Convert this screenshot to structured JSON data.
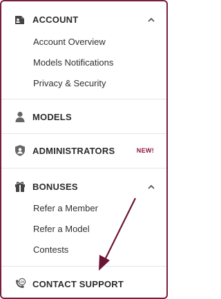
{
  "menu": {
    "account": {
      "label": "ACCOUNT",
      "items": [
        "Account Overview",
        "Models Notifications",
        "Privacy & Security"
      ]
    },
    "models": {
      "label": "MODELS"
    },
    "administrators": {
      "label": "ADMINISTRATORS",
      "badge": "NEW!"
    },
    "bonuses": {
      "label": "BONUSES",
      "items": [
        "Refer a Member",
        "Refer a Model",
        "Contests"
      ]
    },
    "contact": {
      "label": "CONTACT SUPPORT"
    }
  },
  "colors": {
    "frame": "#7a1d3a",
    "badge": "#8b1538",
    "icon": "#555555",
    "arrow": "#6b1535"
  },
  "icons": {
    "account": "id-card-icon",
    "models": "person-icon",
    "administrators": "shield-user-icon",
    "bonuses": "gift-icon",
    "contact": "phone-24-icon",
    "expanded": "chevron-up-icon"
  }
}
